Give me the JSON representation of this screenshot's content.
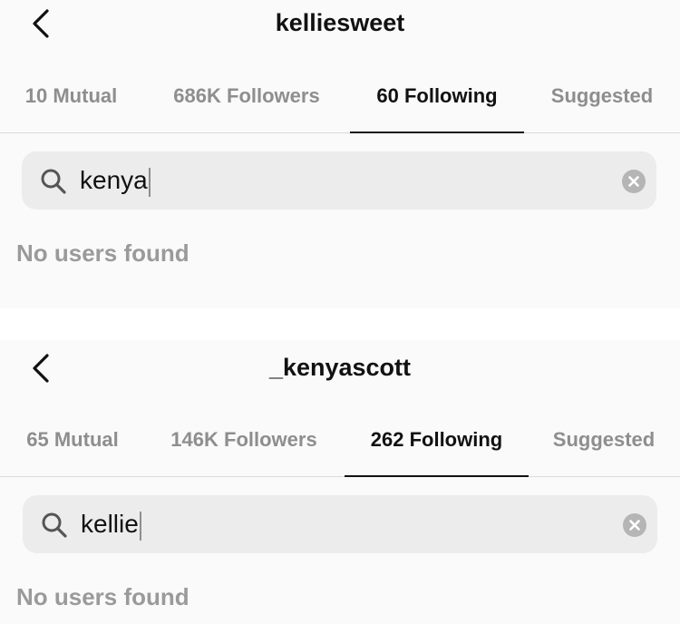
{
  "screens": [
    {
      "title": "kelliesweet",
      "tabs": [
        {
          "label": "10 Mutual",
          "active": false
        },
        {
          "label": "686K Followers",
          "active": false
        },
        {
          "label": "60 Following",
          "active": true
        },
        {
          "label": "Suggested",
          "active": false
        }
      ],
      "search": {
        "value": "kenya"
      },
      "empty_message": "No users found"
    },
    {
      "title": "_kenyascott",
      "tabs": [
        {
          "label": "65 Mutual",
          "active": false
        },
        {
          "label": "146K Followers",
          "active": false
        },
        {
          "label": "262 Following",
          "active": true
        },
        {
          "label": "Suggested",
          "active": false
        }
      ],
      "search": {
        "value": "kellie"
      },
      "empty_message": "No users found"
    }
  ],
  "icons": {
    "back": "chevron-left-icon",
    "search": "search-icon",
    "clear": "clear-icon"
  },
  "colors": {
    "background": "#fafafa",
    "text_primary": "#111111",
    "text_muted": "#8e8e8e",
    "search_bg": "#ececec"
  }
}
